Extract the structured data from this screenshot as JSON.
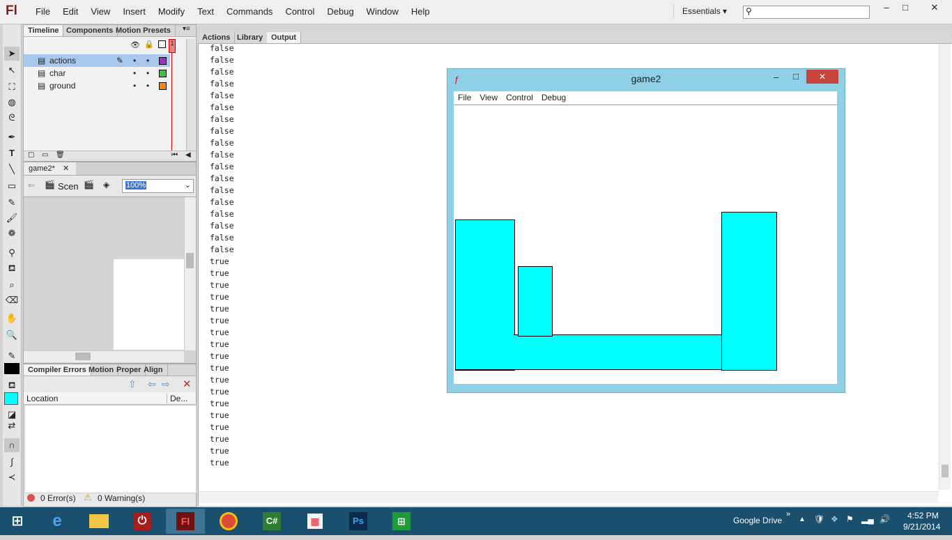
{
  "app": {
    "logo": "Fl",
    "menu": [
      "File",
      "Edit",
      "View",
      "Insert",
      "Modify",
      "Text",
      "Commands",
      "Control",
      "Debug",
      "Window",
      "Help"
    ],
    "workspace": "Essentials"
  },
  "timeline": {
    "tabs": [
      "Timeline",
      "Components",
      "Motion Presets"
    ],
    "layers": [
      {
        "name": "actions",
        "color": "#9b30c9"
      },
      {
        "name": "char",
        "color": "#33cc33"
      },
      {
        "name": "ground",
        "color": "#ff8800"
      }
    ],
    "frame_marker": "1"
  },
  "stage": {
    "doc_tab": "game2*",
    "scene_label": "Scen",
    "zoom": "100%"
  },
  "compiler": {
    "tabs": [
      "Compiler Errors",
      "Motion",
      "Proper",
      "Align"
    ],
    "col_location": "Location",
    "col_desc": "De...",
    "errors": "0 Error(s)",
    "warnings": "0 Warning(s)"
  },
  "output_panel": {
    "tabs": [
      "Actions",
      "Library",
      "Output"
    ],
    "lines": [
      "false",
      "false",
      "false",
      "false",
      "false",
      "false",
      "false",
      "false",
      "false",
      "false",
      "false",
      "false",
      "false",
      "false",
      "false",
      "false",
      "false",
      "false",
      "true",
      "true",
      "true",
      "true",
      "true",
      "true",
      "true",
      "true",
      "true",
      "true",
      "true",
      "true",
      "true",
      "true",
      "true",
      "true",
      "true",
      "true"
    ]
  },
  "game_window": {
    "title": "game2",
    "menu": [
      "File",
      "View",
      "Control",
      "Debug"
    ],
    "fill_color": "#00ffff"
  },
  "taskbar": {
    "google_drive": "Google Drive",
    "time": "4:52 PM",
    "date": "9/21/2014"
  }
}
